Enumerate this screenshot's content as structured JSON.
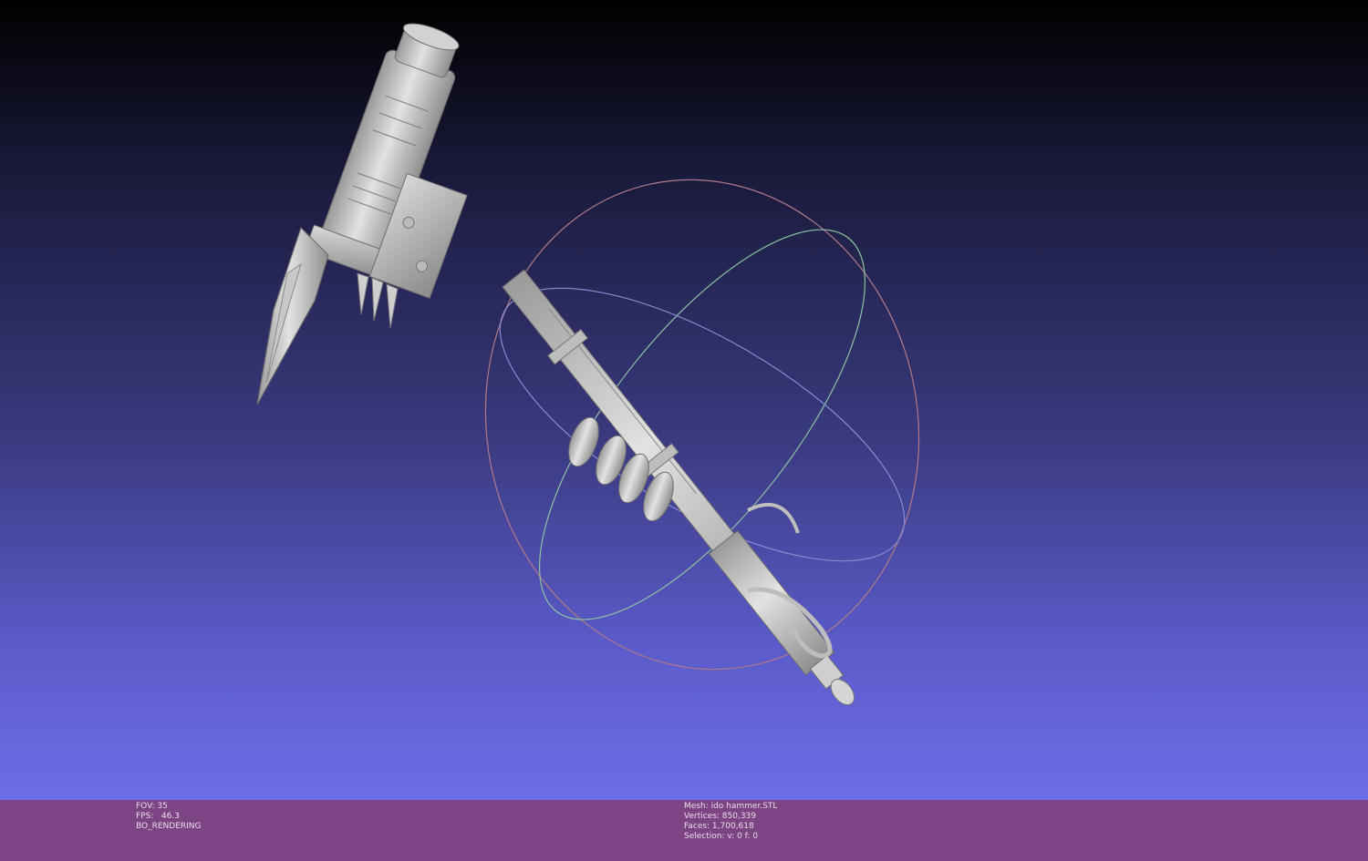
{
  "viewer": {
    "background_top": "#000000",
    "background_bottom": "#6d6ee8",
    "status_bar_color": "#7d4484",
    "trackball_colors": {
      "ring_red": "#c08080",
      "ring_green": "#80c8a0",
      "ring_blue": "#8080d0"
    }
  },
  "status_left": {
    "fov": "FOV: 35",
    "fps": "FPS:   46.3",
    "mode": "BO_RENDERING"
  },
  "status_right": {
    "mesh": "Mesh: ido hammer.STL",
    "vertices": "Vertices: 850,339",
    "faces": "Faces: 1,700,618",
    "selection": "Selection: v: 0 f: 0"
  }
}
